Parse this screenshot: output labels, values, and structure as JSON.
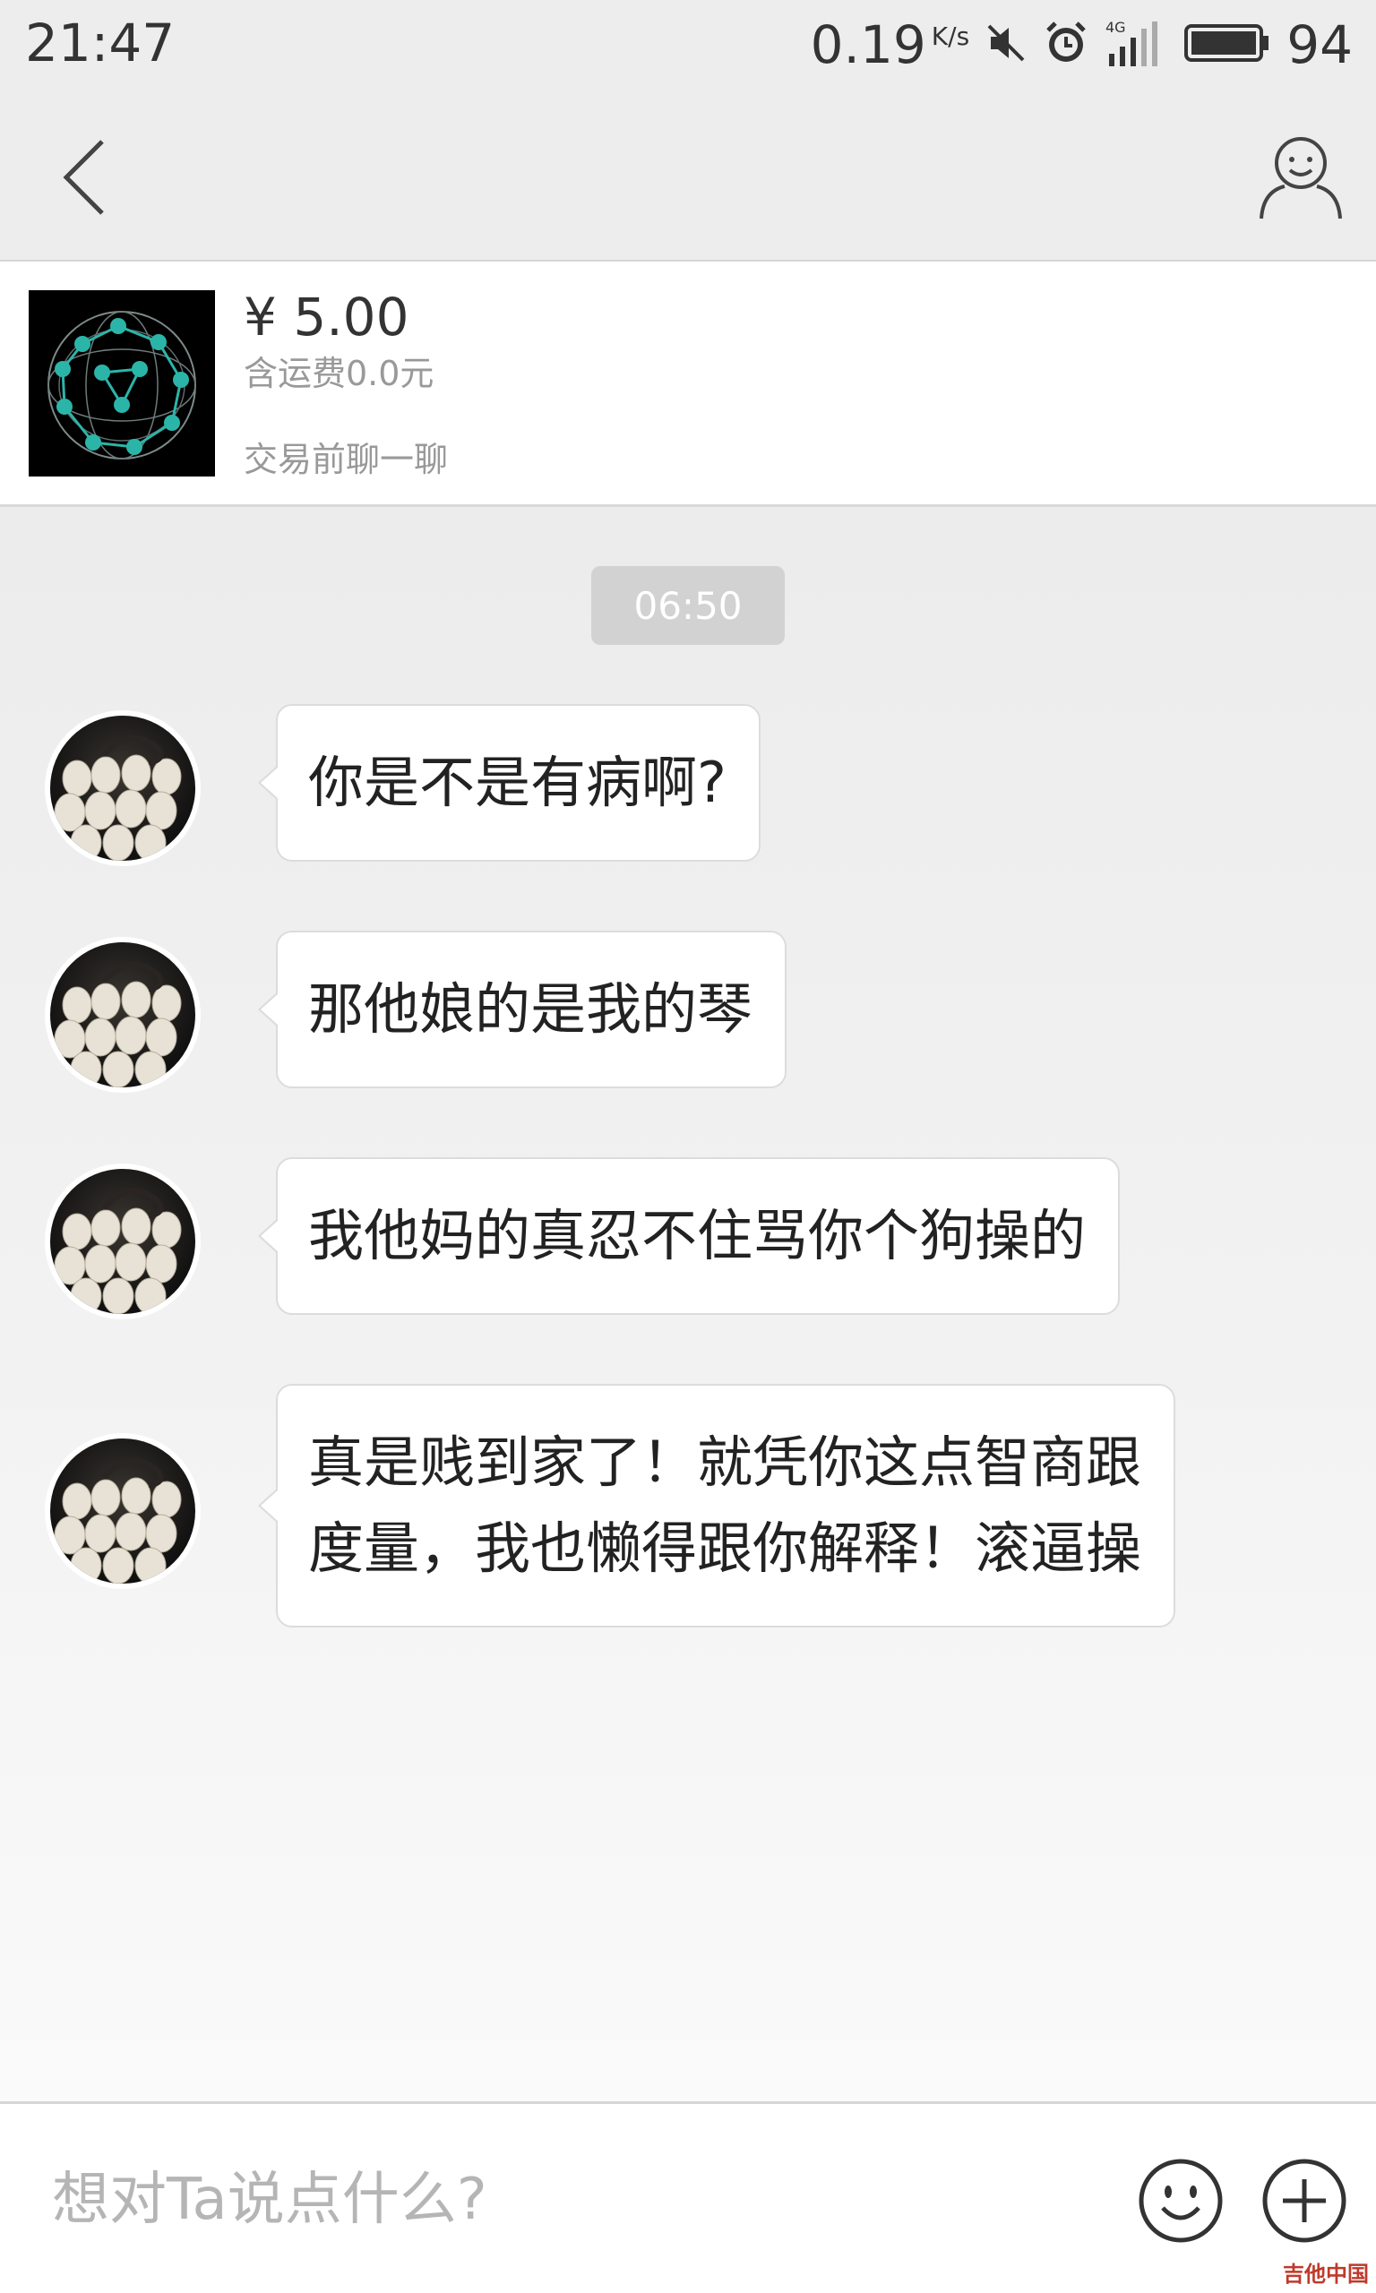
{
  "status_bar": {
    "time": "21:47",
    "net_speed": "0.19",
    "net_unit": "K/s",
    "network": "4G",
    "battery": "94"
  },
  "product": {
    "price": "¥ 5.00",
    "shipping": "含运费0.0元",
    "note": "交易前聊一聊"
  },
  "chat": {
    "timestamp": "06:50",
    "messages": [
      {
        "text": "你是不是有病啊?"
      },
      {
        "text": "那他娘的是我的琴"
      },
      {
        "text": "我他妈的真忍不住骂你个狗操的"
      },
      {
        "line1": "真是贱到家了！就凭你这点智商跟",
        "line2": "度量，我也懒得跟你解释！滚逼操"
      }
    ]
  },
  "input": {
    "placeholder": "想对Ta说点什么?"
  },
  "watermark": "吉他中国",
  "colors": {
    "background": "#ececec",
    "bubble": "#ffffff",
    "placeholder": "#b5b5b5",
    "time_pill": "#d2d2d2"
  }
}
